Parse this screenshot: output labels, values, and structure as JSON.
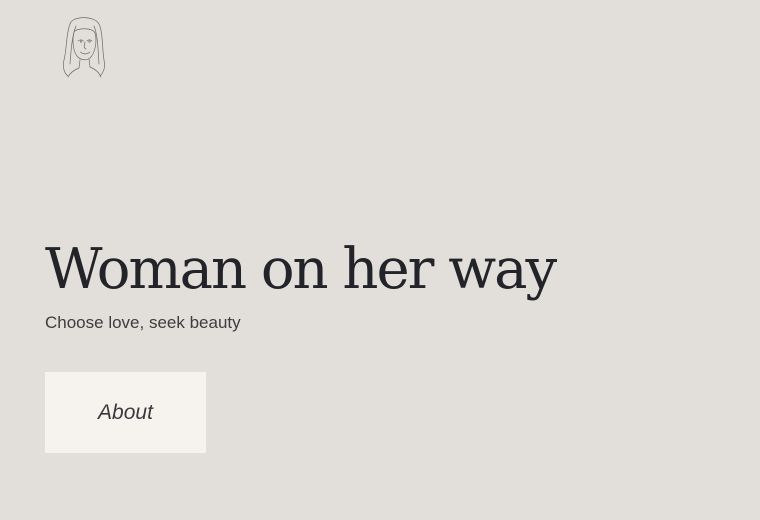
{
  "header": {
    "logo_icon": "line-drawing-portrait-icon"
  },
  "hero": {
    "title": "Woman on her way",
    "subtitle": "Choose love, seek beauty"
  },
  "actions": {
    "about_label": "About"
  },
  "colors": {
    "background": "#e2ded9",
    "button_background": "#f6f2ee",
    "title_text": "#22242a",
    "subtitle_text": "#3d3d3f"
  }
}
